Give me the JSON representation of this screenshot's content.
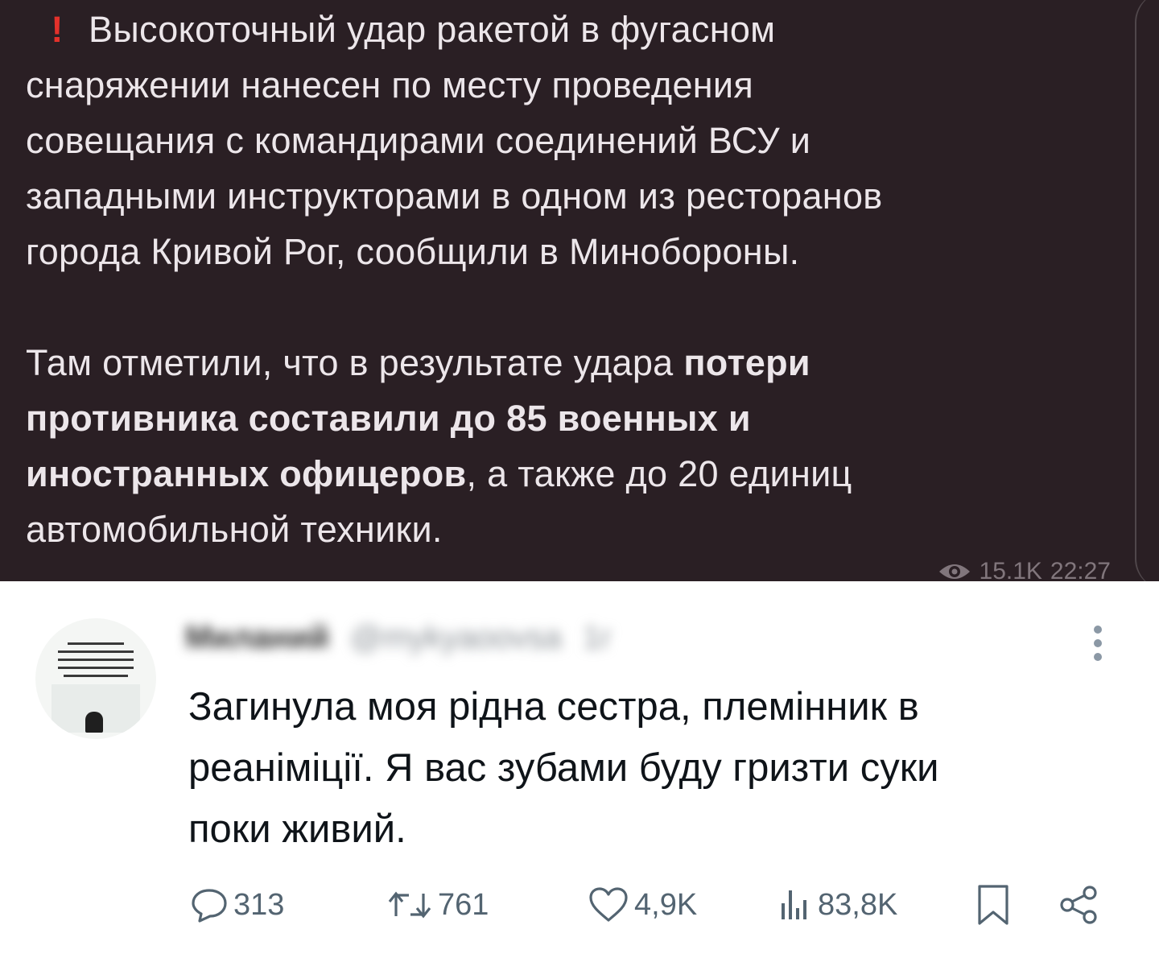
{
  "telegram_post": {
    "alert_glyph": "!",
    "paragraph1_lines": [
      "Высокоточный удар ракетой в фугасном",
      "снаряжении нанесен по месту проведения",
      "совещания с командирами соединений ВСУ и",
      "западными инструкторами в одном из ресторанов",
      "города Кривой Рог, сообщили в Минобороны."
    ],
    "paragraph2": {
      "line1_regular": "Там отметили, что в результате удара ",
      "line1_bold": "потери",
      "line2_bold": "противника составили до 85 военных и",
      "line3_bold": "иностранных офицеров",
      "line3_regular": ", а также до 20 единиц",
      "line4_regular": "автомобильной техники."
    },
    "views": "15.1K",
    "time": "22:27",
    "alert_color": "#e4312b"
  },
  "tweet": {
    "author_name": "Миланий",
    "author_handle": "@mykyaoovsa",
    "author_time": "1г",
    "text_lines": [
      "Загинула моя рідна сестра, племінник в",
      "реаніміції. Я вас зубами буду гризти суки",
      "поки живий."
    ],
    "actions": {
      "replies": "313",
      "reposts": "761",
      "likes": "4,9K",
      "views": "83,8K"
    }
  }
}
